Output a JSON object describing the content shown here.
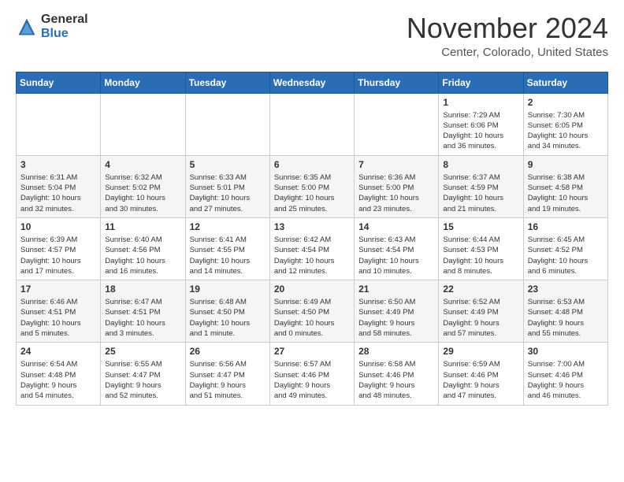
{
  "header": {
    "logo": {
      "general": "General",
      "blue": "Blue"
    },
    "title": "November 2024",
    "location": "Center, Colorado, United States"
  },
  "calendar": {
    "days_of_week": [
      "Sunday",
      "Monday",
      "Tuesday",
      "Wednesday",
      "Thursday",
      "Friday",
      "Saturday"
    ],
    "weeks": [
      {
        "row_index": 0,
        "days": [
          {
            "num": "",
            "info": ""
          },
          {
            "num": "",
            "info": ""
          },
          {
            "num": "",
            "info": ""
          },
          {
            "num": "",
            "info": ""
          },
          {
            "num": "",
            "info": ""
          },
          {
            "num": "1",
            "info": "Sunrise: 7:29 AM\nSunset: 6:06 PM\nDaylight: 10 hours\nand 36 minutes."
          },
          {
            "num": "2",
            "info": "Sunrise: 7:30 AM\nSunset: 6:05 PM\nDaylight: 10 hours\nand 34 minutes."
          }
        ]
      },
      {
        "row_index": 1,
        "days": [
          {
            "num": "3",
            "info": "Sunrise: 6:31 AM\nSunset: 5:04 PM\nDaylight: 10 hours\nand 32 minutes."
          },
          {
            "num": "4",
            "info": "Sunrise: 6:32 AM\nSunset: 5:02 PM\nDaylight: 10 hours\nand 30 minutes."
          },
          {
            "num": "5",
            "info": "Sunrise: 6:33 AM\nSunset: 5:01 PM\nDaylight: 10 hours\nand 27 minutes."
          },
          {
            "num": "6",
            "info": "Sunrise: 6:35 AM\nSunset: 5:00 PM\nDaylight: 10 hours\nand 25 minutes."
          },
          {
            "num": "7",
            "info": "Sunrise: 6:36 AM\nSunset: 5:00 PM\nDaylight: 10 hours\nand 23 minutes."
          },
          {
            "num": "8",
            "info": "Sunrise: 6:37 AM\nSunset: 4:59 PM\nDaylight: 10 hours\nand 21 minutes."
          },
          {
            "num": "9",
            "info": "Sunrise: 6:38 AM\nSunset: 4:58 PM\nDaylight: 10 hours\nand 19 minutes."
          }
        ]
      },
      {
        "row_index": 2,
        "days": [
          {
            "num": "10",
            "info": "Sunrise: 6:39 AM\nSunset: 4:57 PM\nDaylight: 10 hours\nand 17 minutes."
          },
          {
            "num": "11",
            "info": "Sunrise: 6:40 AM\nSunset: 4:56 PM\nDaylight: 10 hours\nand 16 minutes."
          },
          {
            "num": "12",
            "info": "Sunrise: 6:41 AM\nSunset: 4:55 PM\nDaylight: 10 hours\nand 14 minutes."
          },
          {
            "num": "13",
            "info": "Sunrise: 6:42 AM\nSunset: 4:54 PM\nDaylight: 10 hours\nand 12 minutes."
          },
          {
            "num": "14",
            "info": "Sunrise: 6:43 AM\nSunset: 4:54 PM\nDaylight: 10 hours\nand 10 minutes."
          },
          {
            "num": "15",
            "info": "Sunrise: 6:44 AM\nSunset: 4:53 PM\nDaylight: 10 hours\nand 8 minutes."
          },
          {
            "num": "16",
            "info": "Sunrise: 6:45 AM\nSunset: 4:52 PM\nDaylight: 10 hours\nand 6 minutes."
          }
        ]
      },
      {
        "row_index": 3,
        "days": [
          {
            "num": "17",
            "info": "Sunrise: 6:46 AM\nSunset: 4:51 PM\nDaylight: 10 hours\nand 5 minutes."
          },
          {
            "num": "18",
            "info": "Sunrise: 6:47 AM\nSunset: 4:51 PM\nDaylight: 10 hours\nand 3 minutes."
          },
          {
            "num": "19",
            "info": "Sunrise: 6:48 AM\nSunset: 4:50 PM\nDaylight: 10 hours\nand 1 minute."
          },
          {
            "num": "20",
            "info": "Sunrise: 6:49 AM\nSunset: 4:50 PM\nDaylight: 10 hours\nand 0 minutes."
          },
          {
            "num": "21",
            "info": "Sunrise: 6:50 AM\nSunset: 4:49 PM\nDaylight: 9 hours\nand 58 minutes."
          },
          {
            "num": "22",
            "info": "Sunrise: 6:52 AM\nSunset: 4:49 PM\nDaylight: 9 hours\nand 57 minutes."
          },
          {
            "num": "23",
            "info": "Sunrise: 6:53 AM\nSunset: 4:48 PM\nDaylight: 9 hours\nand 55 minutes."
          }
        ]
      },
      {
        "row_index": 4,
        "days": [
          {
            "num": "24",
            "info": "Sunrise: 6:54 AM\nSunset: 4:48 PM\nDaylight: 9 hours\nand 54 minutes."
          },
          {
            "num": "25",
            "info": "Sunrise: 6:55 AM\nSunset: 4:47 PM\nDaylight: 9 hours\nand 52 minutes."
          },
          {
            "num": "26",
            "info": "Sunrise: 6:56 AM\nSunset: 4:47 PM\nDaylight: 9 hours\nand 51 minutes."
          },
          {
            "num": "27",
            "info": "Sunrise: 6:57 AM\nSunset: 4:46 PM\nDaylight: 9 hours\nand 49 minutes."
          },
          {
            "num": "28",
            "info": "Sunrise: 6:58 AM\nSunset: 4:46 PM\nDaylight: 9 hours\nand 48 minutes."
          },
          {
            "num": "29",
            "info": "Sunrise: 6:59 AM\nSunset: 4:46 PM\nDaylight: 9 hours\nand 47 minutes."
          },
          {
            "num": "30",
            "info": "Sunrise: 7:00 AM\nSunset: 4:46 PM\nDaylight: 9 hours\nand 46 minutes."
          }
        ]
      }
    ]
  }
}
